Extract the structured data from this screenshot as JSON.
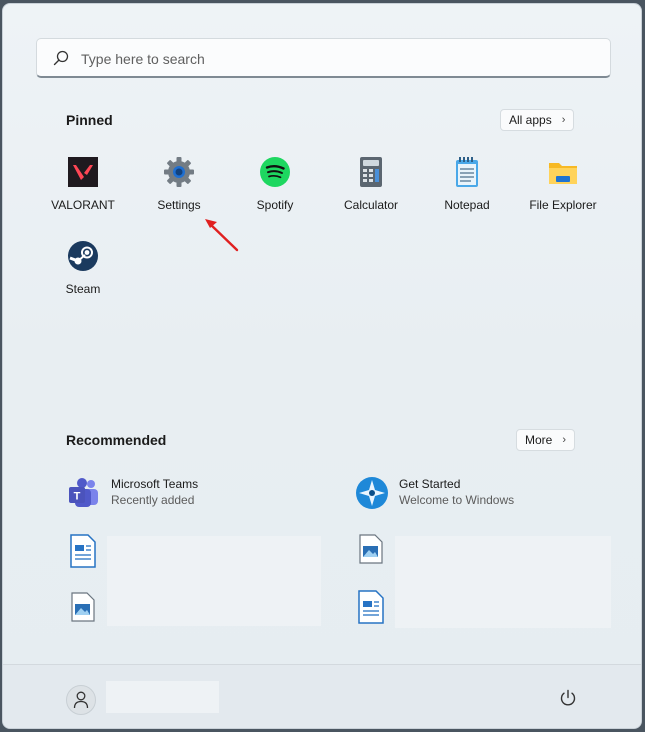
{
  "search": {
    "placeholder": "Type here to search"
  },
  "pinned": {
    "title": "Pinned",
    "all_apps_label": "All apps",
    "apps": [
      {
        "label": "VALORANT",
        "icon": "valorant-icon"
      },
      {
        "label": "Settings",
        "icon": "settings-gear-icon"
      },
      {
        "label": "Spotify",
        "icon": "spotify-icon"
      },
      {
        "label": "Calculator",
        "icon": "calculator-icon"
      },
      {
        "label": "Notepad",
        "icon": "notepad-icon"
      },
      {
        "label": "File Explorer",
        "icon": "folder-icon"
      },
      {
        "label": "Steam",
        "icon": "steam-icon"
      }
    ]
  },
  "recommended": {
    "title": "Recommended",
    "more_label": "More",
    "items": [
      {
        "title": "Microsoft Teams",
        "subtitle": "Recently added",
        "icon": "teams-icon"
      },
      {
        "title": "Get Started",
        "subtitle": "Welcome to Windows",
        "icon": "get-started-icon"
      },
      {
        "title": "",
        "subtitle": "",
        "icon": "document-icon"
      },
      {
        "title": "",
        "subtitle": "",
        "icon": "image-file-icon"
      },
      {
        "title": "",
        "subtitle": "",
        "icon": "image-file-icon"
      },
      {
        "title": "",
        "subtitle": "",
        "icon": "document-icon"
      }
    ]
  },
  "footer": {
    "user_icon": "user-avatar-icon",
    "power_icon": "power-icon"
  },
  "colors": {
    "annotation_arrow": "#e02020",
    "accent": "#0067c0"
  }
}
